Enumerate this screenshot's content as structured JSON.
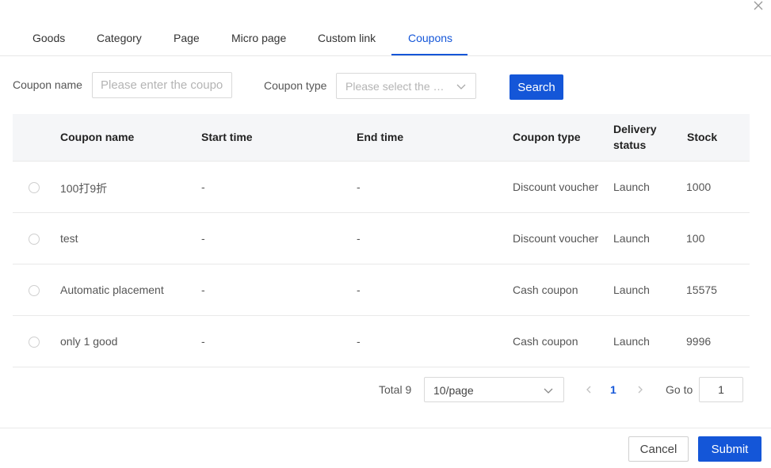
{
  "tabs": [
    {
      "label": "Goods"
    },
    {
      "label": "Category"
    },
    {
      "label": "Page"
    },
    {
      "label": "Micro page"
    },
    {
      "label": "Custom link"
    },
    {
      "label": "Coupons",
      "active": true
    }
  ],
  "filters": {
    "coupon_name_label": "Coupon name",
    "coupon_name_placeholder": "Please enter the coupon name",
    "coupon_type_label": "Coupon type",
    "coupon_type_placeholder": "Please select the coupon type",
    "search_label": "Search"
  },
  "table": {
    "headers": {
      "name": "Coupon name",
      "start": "Start time",
      "end": "End time",
      "type": "Coupon type",
      "delivery_line1": "Delivery",
      "delivery_line2": "status",
      "stock": "Stock"
    },
    "rows": [
      {
        "name": "100打9折",
        "start": "-",
        "end": "-",
        "type": "Discount voucher",
        "status": "Launch",
        "stock": "1000"
      },
      {
        "name": "test",
        "start": "-",
        "end": "-",
        "type": "Discount voucher",
        "status": "Launch",
        "stock": "100"
      },
      {
        "name": "Automatic placement",
        "start": "-",
        "end": "-",
        "type": "Cash coupon",
        "status": "Launch",
        "stock": "15575"
      },
      {
        "name": "only 1 good",
        "start": "-",
        "end": "-",
        "type": "Cash coupon",
        "status": "Launch",
        "stock": "9996"
      }
    ]
  },
  "pagination": {
    "total_label": "Total 9",
    "page_size": "10/page",
    "current_page": "1",
    "goto_label": "Go to",
    "goto_value": "1"
  },
  "footer": {
    "cancel_label": "Cancel",
    "submit_label": "Submit"
  },
  "colors": {
    "accent": "#1456d8",
    "header_bg": "#f5f6f8"
  }
}
